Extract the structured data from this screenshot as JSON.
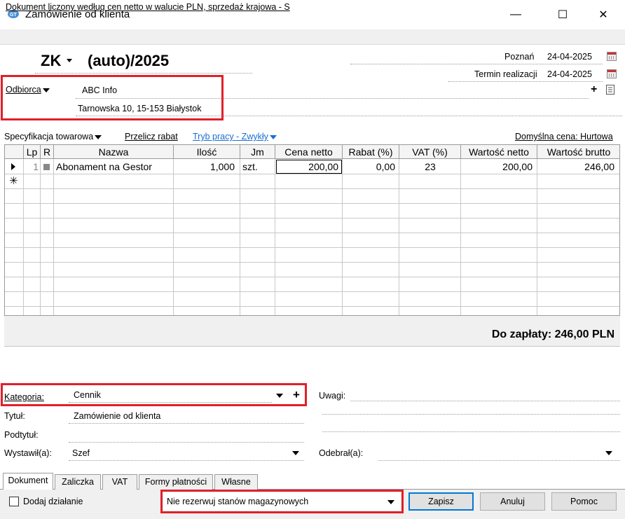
{
  "window": {
    "title": "Zamówienie od klienta",
    "minimize": "—",
    "maximize": "☐",
    "close": "✕"
  },
  "info_bar": "Dokument liczony według cen netto w walucie PLN, sprzedaż krajowa - S",
  "document": {
    "type": "ZK",
    "number": "(auto)/2025",
    "place_label": "Poznań",
    "place_date": "24-04-2025",
    "due_label": "Termin realizacji",
    "due_date": "24-04-2025"
  },
  "recipient": {
    "label": "Odbiorca",
    "name": "ABC Info",
    "address": "Tarnowska 10, 15-153 Białystok"
  },
  "toolbar": {
    "specification": "Specyfikacja towarowa",
    "recalc_discount": "Przelicz rabat",
    "work_mode": "Tryb pracy - Zwykły",
    "default_price": "Domyślna cena: Hurtowa"
  },
  "grid": {
    "columns": [
      "Lp",
      "R",
      "Nazwa",
      "Ilość",
      "Jm",
      "Cena netto",
      "Rabat (%)",
      "VAT (%)",
      "Wartość netto",
      "Wartość brutto"
    ],
    "rows": [
      {
        "lp": "1",
        "r": "",
        "nazwa": "Abonament na Gestor",
        "ilosc": "1,000",
        "jm": "szt.",
        "cena_netto": "200,00",
        "rabat": "0,00",
        "vat": "23",
        "wartosc_netto": "200,00",
        "wartosc_brutto": "246,00"
      }
    ],
    "new_row_marker": "✳"
  },
  "total": "Do zapłaty: 246,00 PLN",
  "form": {
    "category_label": "Kategoria:",
    "category_value": "Cennik",
    "category_add": "+",
    "title_label": "Tytuł:",
    "title_value": "Zamówienie od klienta",
    "subtitle_label": "Podtytuł:",
    "subtitle_value": "",
    "issued_label": "Wystawił(a):",
    "issued_value": "Szef",
    "notes_label": "Uwagi:",
    "received_label": "Odebrał(a):",
    "received_value": ""
  },
  "tabs": [
    "Dokument",
    "Zaliczka",
    "VAT",
    "Formy płatności",
    "Własne"
  ],
  "bottom": {
    "add_action": "Dodaj działanie",
    "reservation": "Nie rezerwuj stanów magazynowych",
    "save": "Zapisz",
    "cancel": "Anuluj",
    "help": "Pomoc"
  },
  "colors": {
    "highlight": "#e0202a",
    "link": "#1a6fd1"
  }
}
